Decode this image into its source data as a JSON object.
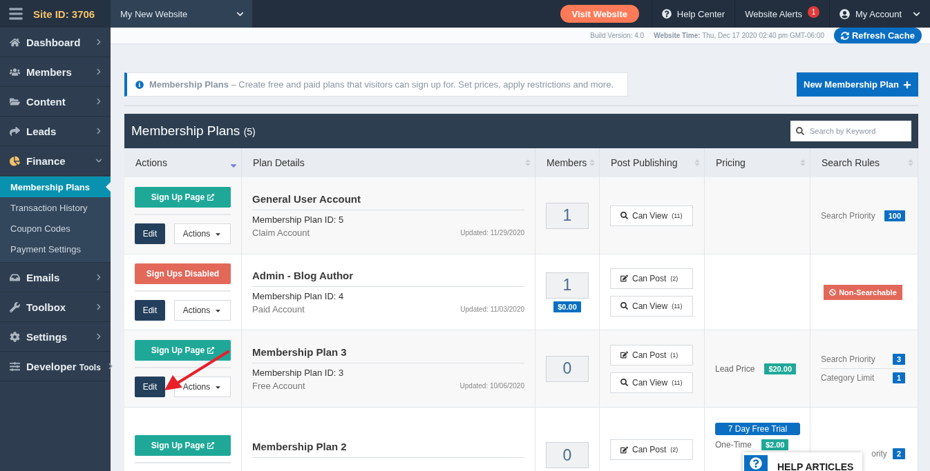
{
  "topbar": {
    "site_id": "Site ID: 3706",
    "website_select": "My New Website",
    "visit_button": "Visit Website",
    "help": "Help Center",
    "alerts": {
      "label": "Website Alerts",
      "count": "1"
    },
    "account": "My Account"
  },
  "subbar": {
    "build": "Build Version: 4.0",
    "time": "**Website Time:** Thu, Dec 17 2020 02:40 pm GMT-06:00",
    "refresh": "Refresh Cache"
  },
  "sidebar": {
    "items": [
      {
        "label": "Dashboard",
        "expanded": false
      },
      {
        "label": "Members",
        "expanded": false
      },
      {
        "label": "Content",
        "expanded": false
      },
      {
        "label": "Leads",
        "expanded": false
      },
      {
        "label": "Finance",
        "expanded": true,
        "children": [
          {
            "label": "Membership Plans",
            "selected": true
          },
          {
            "label": "Transaction History",
            "selected": false
          },
          {
            "label": "Coupon Codes",
            "selected": false
          },
          {
            "label": "Payment Settings",
            "selected": false
          }
        ]
      },
      {
        "label": "Emails",
        "expanded": false
      },
      {
        "label": "Toolbox",
        "expanded": false
      },
      {
        "label": "Settings",
        "expanded": false
      },
      {
        "label": "Developer",
        "note": "Tools",
        "expanded": false
      }
    ]
  },
  "info": "**Membership Plans** – Create free and paid plans that visitors can sign up for. Set prices, apply restrictions and more.",
  "new_button": "New Membership Plan",
  "table": {
    "title": "Membership Plans",
    "count": "(5)",
    "search": {
      "placeholder": "Search by Keyword"
    },
    "columns": [
      {
        "label": "Actions",
        "sorted": true
      },
      {
        "label": "Plan Details",
        "sorted": false
      },
      {
        "label": "Members",
        "sorted": false
      },
      {
        "label": "Post Publishing",
        "sorted": false
      },
      {
        "label": "Pricing",
        "sorted": false
      },
      {
        "label": "Search Rules",
        "sorted": false
      }
    ],
    "rows": [
      {
        "signup": {
          "label": "Sign Up Page",
          "kind": "enabled"
        },
        "edit": "Edit",
        "actions": "Actions",
        "title": "General User Account",
        "plan_id": "Membership Plan ID: 5",
        "account": "Claim Account",
        "updated": "Updated: 11/29/2020",
        "members": "1",
        "posts": [
          {
            "kind": "view",
            "label": "Can View",
            "count": "(11)"
          }
        ],
        "pricing": [],
        "search": [
          {
            "kind": "rule",
            "label": "Search Priority",
            "value": "100",
            "covered": false
          }
        ]
      },
      {
        "signup": {
          "label": "Sign Ups Disabled",
          "kind": "disabled"
        },
        "edit": "Edit",
        "actions": "Actions",
        "title": "Admin - Blog Author",
        "plan_id": "Membership Plan ID: 4",
        "account": "Paid Account",
        "updated": "Updated: 11/03/2020",
        "members": "1",
        "member_price": "$0.00",
        "posts": [
          {
            "kind": "post",
            "label": "Can Post",
            "count": "(2)"
          },
          {
            "kind": "view",
            "label": "Can View",
            "count": "(11)"
          }
        ],
        "pricing": [],
        "search": [
          {
            "kind": "flag",
            "label": "Non-Searchable"
          }
        ]
      },
      {
        "signup": {
          "label": "Sign Up Page",
          "kind": "enabled"
        },
        "edit": "Edit",
        "actions": "Actions",
        "title": "Membership Plan 3",
        "plan_id": "Membership Plan ID: 3",
        "account": "Free Account",
        "updated": "Updated: 10/06/2020",
        "members": "0",
        "posts": [
          {
            "kind": "post",
            "label": "Can Post",
            "count": "(1)"
          },
          {
            "kind": "view",
            "label": "Can View",
            "count": "(11)"
          }
        ],
        "pricing": [
          {
            "kind": "price",
            "label": "Lead Price",
            "value": "$20.00"
          }
        ],
        "search": [
          {
            "kind": "rule",
            "label": "Search Priority",
            "value": "3",
            "covered": false
          },
          {
            "kind": "rule",
            "label": "Category Limit",
            "value": "1",
            "covered": false
          }
        ]
      },
      {
        "signup": {
          "label": "Sign Up Page",
          "kind": "enabled"
        },
        "title": "Membership Plan 2",
        "members": "0",
        "posts": [
          {
            "kind": "post",
            "label": "Can Post",
            "count": "(2)"
          }
        ],
        "pricing": [
          {
            "kind": "trial",
            "label": "7 Day Free Trial"
          },
          {
            "kind": "price",
            "label": "One-Time",
            "value": "$2.00"
          }
        ],
        "search": [
          {
            "kind": "rule",
            "label": "ority",
            "value": "2",
            "covered": true
          }
        ]
      }
    ]
  },
  "help_widget": "HELP ARTICLES"
}
